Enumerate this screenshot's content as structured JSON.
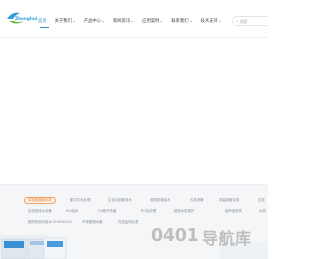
{
  "header": {
    "logo_text": "Zhonghui",
    "nav": [
      {
        "label": "首页",
        "active": true,
        "has_caret": false
      },
      {
        "label": "关于我们",
        "active": false,
        "has_caret": true
      },
      {
        "label": "产品中心",
        "active": false,
        "has_caret": true
      },
      {
        "label": "新闻资讯",
        "active": false,
        "has_caret": true
      },
      {
        "label": "应用案例",
        "active": false,
        "has_caret": true
      },
      {
        "label": "联系我们",
        "active": false,
        "has_caret": true
      },
      {
        "label": "技术支持",
        "active": false,
        "has_caret": true
      }
    ],
    "search": {
      "placeholder": "搜索"
    }
  },
  "tags": {
    "row1": [
      "实验室超纯水机",
      "集中式水处理",
      "生化仪配套用水",
      "液相质谱纯水",
      "石墨消解",
      "测量纯度实验",
      "石墨"
    ],
    "row2": [
      "实验室纯水设备",
      "EDI纯水",
      "UV紫外杀菌",
      "RO反渗透",
      "超纯水机维护",
      "超声波清洗",
      "水质"
    ],
    "row3": [
      "医院检验科用水 ZHONGHUI",
      "不锈钢储水罐",
      "在线监测仪表"
    ]
  },
  "watermark": {
    "number": "0401",
    "text": "导航库"
  },
  "colors": {
    "accent": "#2a8fd0",
    "tag_highlight": "#e8741e",
    "strip_bg": "#f5f6f8"
  }
}
